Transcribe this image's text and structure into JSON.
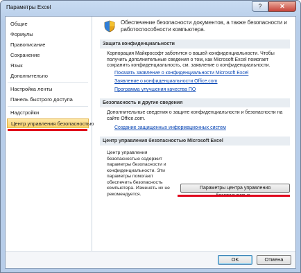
{
  "window": {
    "title": "Параметры Excel",
    "controls": {
      "help": "?",
      "close": "✕"
    }
  },
  "nav": {
    "items": [
      "Общие",
      "Формулы",
      "Правописание",
      "Сохранение",
      "Язык",
      "Дополнительно",
      "Настройка ленты",
      "Панель быстрого доступа",
      "Надстройки",
      "Центр управления безопасностью"
    ],
    "active_index": 9
  },
  "content": {
    "header_text": "Обеспечение безопасности документов, а также безопасности и работоспособности компьютера.",
    "privacy": {
      "title": "Защита конфиденциальности",
      "text": "Корпорация Майкрософт заботится о вашей конфиденциальности. Чтобы получить дополнительные сведения о том, как Microsoft Excel помогает сохранить конфиденциальность, см. заявление о конфиденциальности.",
      "links": [
        "Показать заявление о конфиденциальности Microsoft Excel",
        "Заявление о конфиденциальности Office.com",
        "Программа улучшения качества ПО"
      ]
    },
    "security": {
      "title": "Безопасность и другие сведения",
      "text": "Дополнительные сведения о защите конфиденциальности и безопасности на сайте Office.com.",
      "link": "Создание защищенных информационных систем"
    },
    "trust_center": {
      "title": "Центр управления безопасностью Microsoft Excel",
      "text": "Центр управления безопасностью содержит параметры безопасности и конфиденциальности. Эти параметры помогают обеспечить безопасность компьютера. Изменять их не рекомендуется.",
      "button": "Параметры центра управления безопасностью..."
    }
  },
  "footer": {
    "ok": "OK",
    "cancel": "Отмена"
  },
  "colors": {
    "highlight": "#fbd36a",
    "annotation": "#e0001a",
    "link": "#0644b4"
  }
}
